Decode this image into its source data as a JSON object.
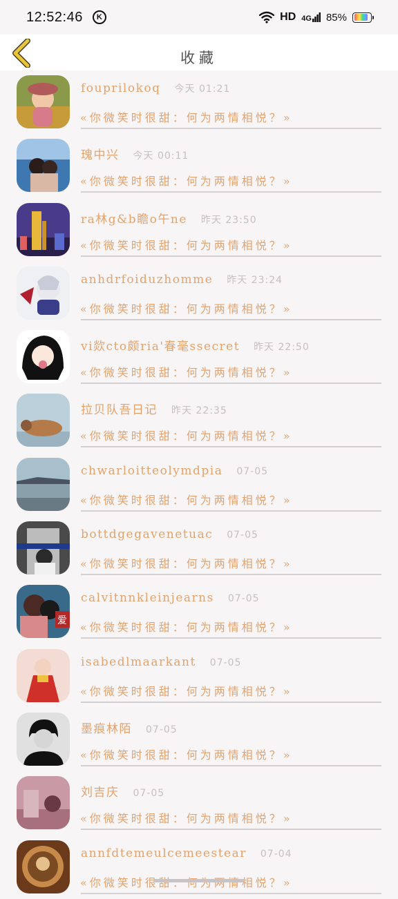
{
  "status_bar": {
    "time": "12:52:46",
    "k_badge": "K",
    "hd": "HD",
    "network": "4G",
    "battery": "85%",
    "battery_level": 0.85
  },
  "header": {
    "title": "收藏"
  },
  "colors": {
    "accent": "#e4a36d",
    "back_icon": "#e9c53a",
    "time_text": "#c6c0c0",
    "divider": "#d4d0d1"
  },
  "items": [
    {
      "name": "fouprilokoq",
      "time": "今天 01:21",
      "quote": "«你微笑时很甜：何为两情相悦？»",
      "avatar": "avatar-girl-hat"
    },
    {
      "name": "瑰中兴",
      "time": "今天 00:11",
      "quote": "«你微笑时很甜：何为两情相悦？»",
      "avatar": "avatar-couple-sea"
    },
    {
      "name": "ra林g&b瞻o午ne",
      "time": "昨天 23:50",
      "quote": "«你微笑时很甜：何为两情相悦？»",
      "avatar": "avatar-city-night"
    },
    {
      "name": "anhdrfoiduzhomme",
      "time": "昨天 23:24",
      "quote": "«你微笑时很甜：何为两情相悦？»",
      "avatar": "avatar-anime-boy"
    },
    {
      "name": "vi欻cto颇ria'春毫ssecret",
      "time": "昨天 22:50",
      "quote": "«你微笑时很甜：何为两情相悦？»",
      "avatar": "avatar-anime-girl"
    },
    {
      "name": "拉贝队吾日记",
      "time": "昨天 22:35",
      "quote": "«你微笑时很甜：何为两情相悦？»",
      "avatar": "avatar-cat"
    },
    {
      "name": "chwarloitteolymdpia",
      "time": "07-05",
      "quote": "«你微笑时很甜：何为两情相悦？»",
      "avatar": "avatar-lake"
    },
    {
      "name": "bottdgegavenetuac",
      "time": "07-05",
      "quote": "«你微笑时很甜：何为两情相悦？»",
      "avatar": "avatar-girl-tunnel"
    },
    {
      "name": "calvitnnkleinjearns",
      "time": "07-05",
      "quote": "«你微笑时很甜：何为两情相悦？»",
      "avatar": "avatar-couple-love",
      "avatar_text": "爱"
    },
    {
      "name": "isabedlmaarkant",
      "time": "07-05",
      "quote": "«你微笑时很甜：何为两情相悦？»",
      "avatar": "avatar-doll-red"
    },
    {
      "name": "墨痕林陌",
      "time": "07-05",
      "quote": "«你微笑时很甜：何为两情相悦？»",
      "avatar": "avatar-boy-bw"
    },
    {
      "name": "刘吉庆",
      "time": "07-05",
      "quote": "«你微笑时很甜：何为两情相悦？»",
      "avatar": "avatar-pink-scene"
    },
    {
      "name": "annfdtemeulcemeestear",
      "time": "07-04",
      "quote": "«你微笑时很甜：何为两情相悦？»",
      "avatar": "avatar-starbucks"
    }
  ]
}
